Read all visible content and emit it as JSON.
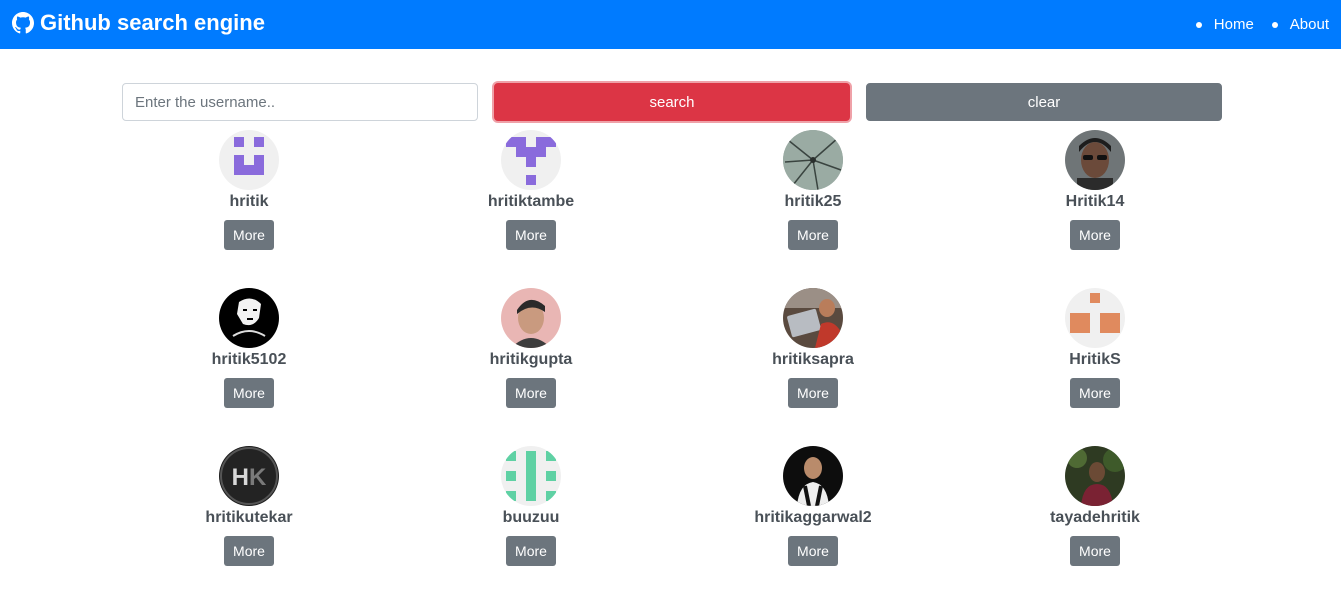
{
  "header": {
    "title": "Github search engine",
    "nav": [
      {
        "label": "Home"
      },
      {
        "label": "About"
      }
    ]
  },
  "search": {
    "placeholder": "Enter the username..",
    "value": "",
    "search_label": "search",
    "clear_label": "clear"
  },
  "users": [
    {
      "login": "hritik",
      "more_label": "More",
      "avatar": "identicon-purple-1"
    },
    {
      "login": "hritiktambe",
      "more_label": "More",
      "avatar": "identicon-purple-2"
    },
    {
      "login": "hritik25",
      "more_label": "More",
      "avatar": "photo-cracked-glass"
    },
    {
      "login": "Hritik14",
      "more_label": "More",
      "avatar": "photo-sunglasses"
    },
    {
      "login": "hritik5102",
      "more_label": "More",
      "avatar": "photo-bw-sketch"
    },
    {
      "login": "hritikgupta",
      "more_label": "More",
      "avatar": "photo-portrait"
    },
    {
      "login": "hritiksapra",
      "more_label": "More",
      "avatar": "photo-laptop"
    },
    {
      "login": "HritikS",
      "more_label": "More",
      "avatar": "identicon-orange"
    },
    {
      "login": "hritikutekar",
      "more_label": "More",
      "avatar": "hk-logo"
    },
    {
      "login": "buuzuu",
      "more_label": "More",
      "avatar": "identicon-green"
    },
    {
      "login": "hritikaggarwal2",
      "more_label": "More",
      "avatar": "photo-dark-portrait"
    },
    {
      "login": "tayadehritik",
      "more_label": "More",
      "avatar": "photo-outdoor"
    }
  ],
  "colors": {
    "navbar": "#007bff",
    "search_button": "#dc3545",
    "clear_button": "#6c757d",
    "more_button": "#6c757d"
  }
}
